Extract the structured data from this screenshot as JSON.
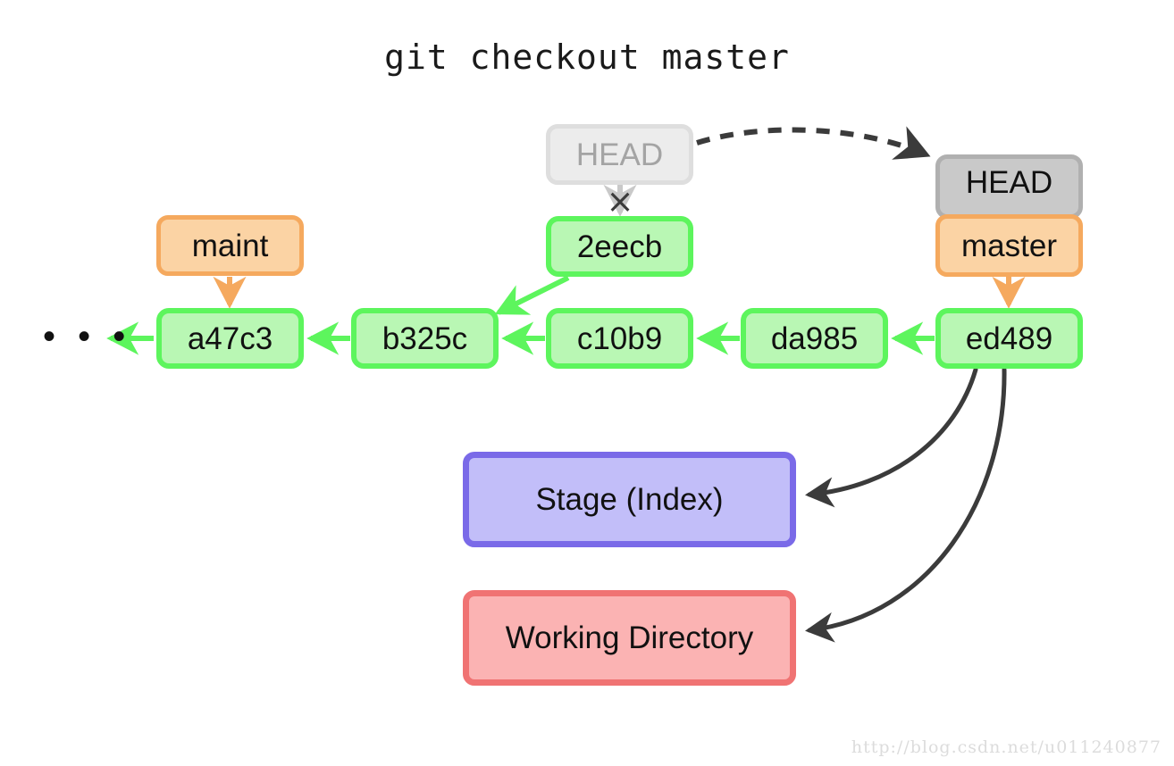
{
  "title": "git checkout master",
  "watermark": "http://blog.csdn.net/u011240877",
  "ellipsis": "• • •",
  "xmark": "×",
  "colors": {
    "commit_fill": "#b9f7b4",
    "commit_border": "#5df55d",
    "ref_orange_fill": "#fbd3a4",
    "ref_orange_border": "#f5a95e",
    "head_fill": "#c9c9c9",
    "head_border": "#b0b0b0",
    "head_faded_fill": "#ececec",
    "head_faded_border": "#dedede",
    "head_faded_text": "#a4a4a4",
    "stage_fill": "#c2bef9",
    "stage_border": "#7a6ae8",
    "workdir_fill": "#fbb3b3",
    "workdir_border": "#f07373",
    "arrow_dark": "#3b3b3b",
    "arrow_faded": "#c9c9c9",
    "background": "#ffffff"
  },
  "commits": [
    {
      "label": "a47c3"
    },
    {
      "label": "b325c"
    },
    {
      "label": "c10b9"
    },
    {
      "label": "da985"
    },
    {
      "label": "ed489"
    },
    {
      "label": "2eecb"
    }
  ],
  "refs": {
    "maint": "maint",
    "head_old": "HEAD",
    "head_new": "HEAD",
    "master": "master"
  },
  "areas": {
    "stage": "Stage (Index)",
    "working_directory": "Working Directory"
  }
}
